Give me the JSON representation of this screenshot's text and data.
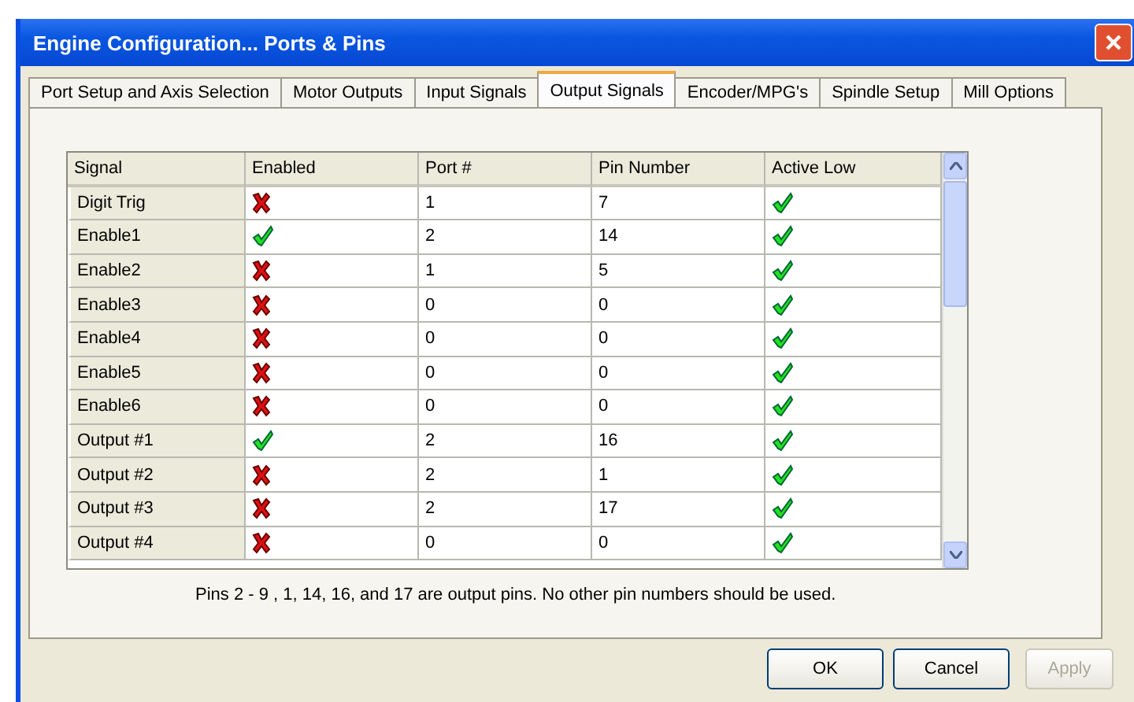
{
  "window": {
    "title": "Engine Configuration... Ports & Pins"
  },
  "tabs": [
    {
      "label": "Port Setup and Axis Selection",
      "selected": false
    },
    {
      "label": "Motor Outputs",
      "selected": false
    },
    {
      "label": "Input Signals",
      "selected": false
    },
    {
      "label": "Output Signals",
      "selected": true
    },
    {
      "label": "Encoder/MPG's",
      "selected": false
    },
    {
      "label": "Spindle Setup",
      "selected": false
    },
    {
      "label": "Mill Options",
      "selected": false
    }
  ],
  "table": {
    "columns": [
      "Signal",
      "Enabled",
      "Port #",
      "Pin Number",
      "Active Low"
    ],
    "rows": [
      {
        "signal": "Digit  Trig",
        "enabled": false,
        "port": "1",
        "pin": "7",
        "active_low": true
      },
      {
        "signal": "Enable1",
        "enabled": true,
        "port": "2",
        "pin": "14",
        "active_low": true
      },
      {
        "signal": "Enable2",
        "enabled": false,
        "port": "1",
        "pin": "5",
        "active_low": true
      },
      {
        "signal": "Enable3",
        "enabled": false,
        "port": "0",
        "pin": "0",
        "active_low": true
      },
      {
        "signal": "Enable4",
        "enabled": false,
        "port": "0",
        "pin": "0",
        "active_low": true
      },
      {
        "signal": "Enable5",
        "enabled": false,
        "port": "0",
        "pin": "0",
        "active_low": true
      },
      {
        "signal": "Enable6",
        "enabled": false,
        "port": "0",
        "pin": "0",
        "active_low": true
      },
      {
        "signal": "Output #1",
        "enabled": true,
        "port": "2",
        "pin": "16",
        "active_low": true
      },
      {
        "signal": "Output #2",
        "enabled": false,
        "port": "2",
        "pin": "1",
        "active_low": true
      },
      {
        "signal": "Output #3",
        "enabled": false,
        "port": "2",
        "pin": "17",
        "active_low": true
      },
      {
        "signal": "Output #4",
        "enabled": false,
        "port": "0",
        "pin": "0",
        "active_low": true
      }
    ]
  },
  "note": "Pins 2 - 9 , 1, 14, 16, and 17 are output pins. No  other pin numbers should be used.",
  "buttons": [
    {
      "label": "OK",
      "disabled": false
    },
    {
      "label": "Cancel",
      "disabled": false
    },
    {
      "label": "Apply",
      "disabled": true
    }
  ]
}
